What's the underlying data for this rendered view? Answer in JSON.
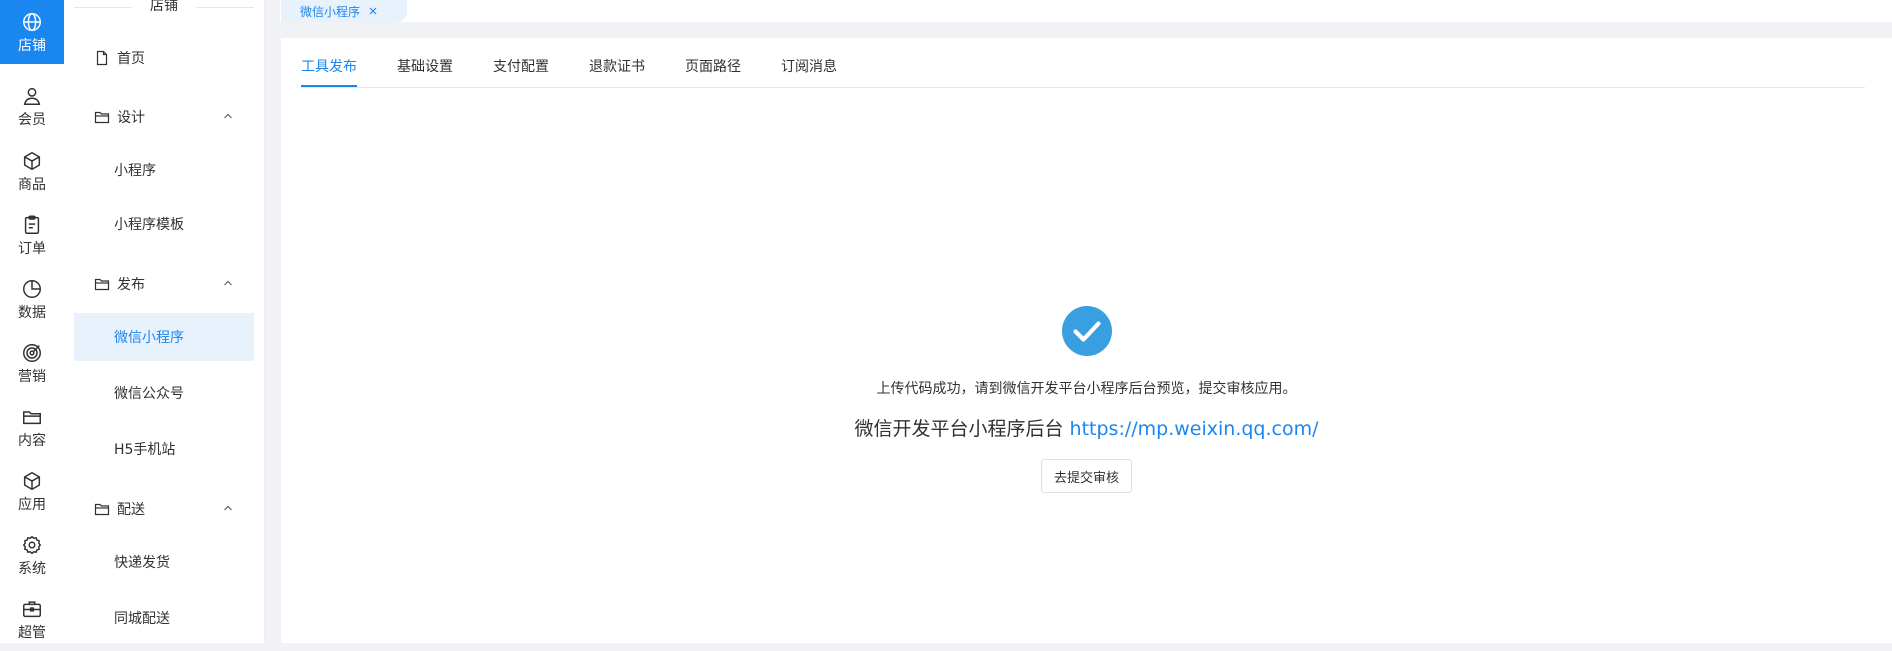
{
  "rail": {
    "items": [
      {
        "label": "店铺",
        "icon": "globe-icon"
      },
      {
        "label": "会员",
        "icon": "user-icon"
      },
      {
        "label": "商品",
        "icon": "box-icon"
      },
      {
        "label": "订单",
        "icon": "clipboard-icon"
      },
      {
        "label": "数据",
        "icon": "pie-chart-icon"
      },
      {
        "label": "营销",
        "icon": "target-icon"
      },
      {
        "label": "内容",
        "icon": "folder-icon"
      },
      {
        "label": "应用",
        "icon": "cube-icon"
      },
      {
        "label": "系统",
        "icon": "gear-icon"
      },
      {
        "label": "超管",
        "icon": "briefcase-icon"
      }
    ]
  },
  "menu": {
    "title": "店铺",
    "home": "首页",
    "groups": [
      {
        "label": "设计",
        "items": [
          "小程序",
          "小程序模板"
        ]
      },
      {
        "label": "发布",
        "items": [
          "微信小程序",
          "微信公众号",
          "H5手机站"
        ]
      },
      {
        "label": "配送",
        "items": [
          "快递发货",
          "同城配送"
        ]
      }
    ]
  },
  "open_tab": {
    "label": "微信小程序"
  },
  "tabs": [
    "工具发布",
    "基础设置",
    "支付配置",
    "退款证书",
    "页面路径",
    "订阅消息"
  ],
  "result": {
    "message": "上传代码成功，请到微信开发平台小程序后台预览，提交审核应用。",
    "platform_label": "微信开发平台小程序后台",
    "platform_url": "https://mp.weixin.qq.com/",
    "submit_button": "去提交审核"
  },
  "colors": {
    "accent": "#1a86f0",
    "success": "#3a9fe0"
  }
}
